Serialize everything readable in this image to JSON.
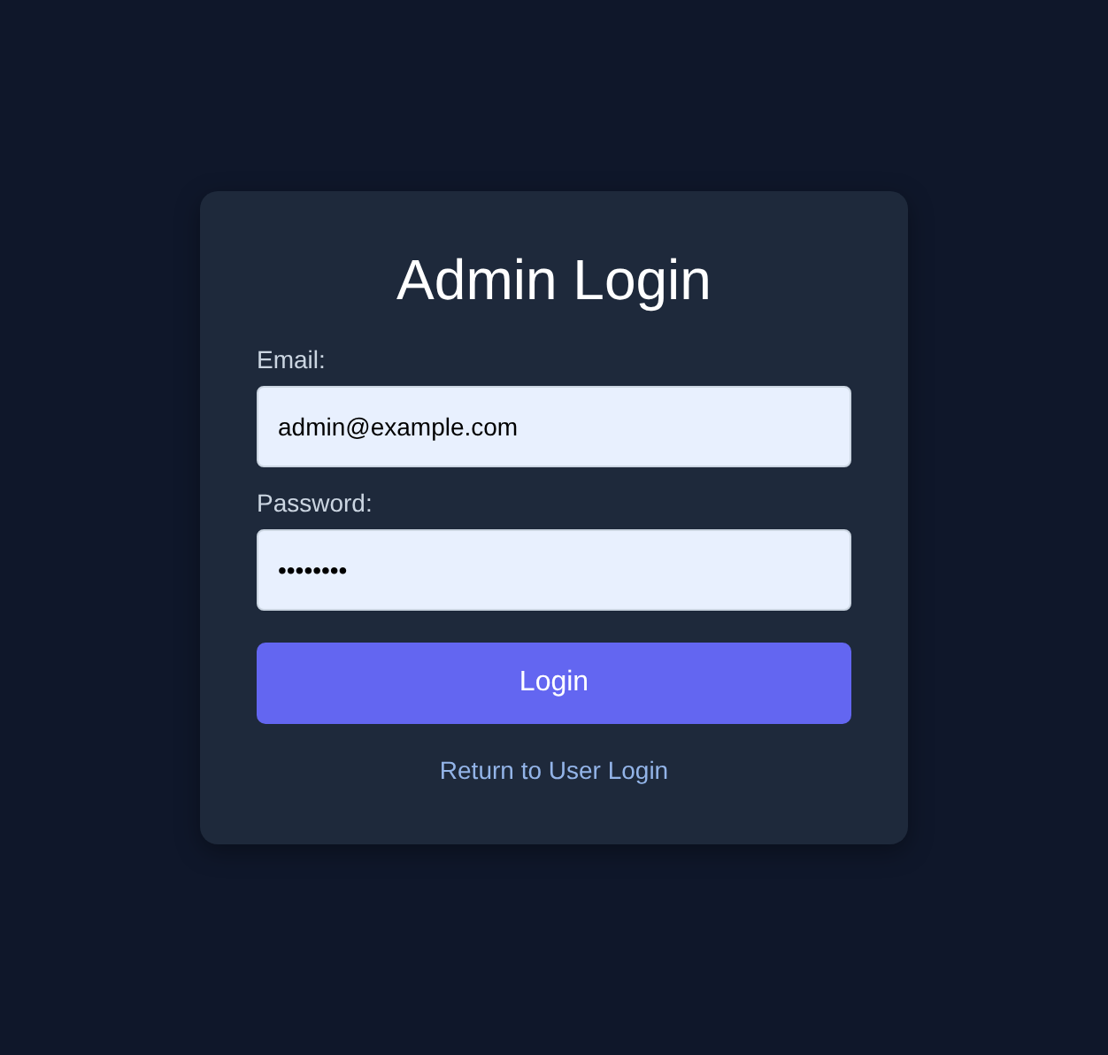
{
  "title": "Admin Login",
  "fields": [
    {
      "label": "Email:",
      "value": "admin@example.com"
    },
    {
      "label": "Password:",
      "value": "••••••••"
    }
  ],
  "button": "Login",
  "link": "Return to User Login"
}
